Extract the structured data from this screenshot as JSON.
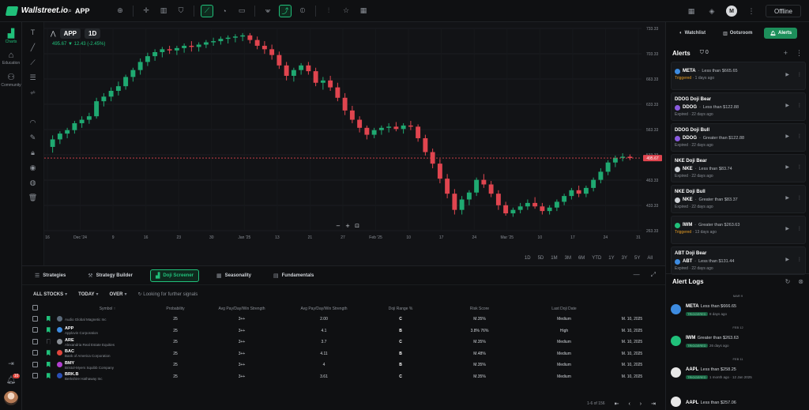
{
  "app": {
    "name": "Wallstreet.io"
  },
  "search": {
    "ticker": "APP"
  },
  "header": {
    "status": "Offline",
    "avatar_initial": "M"
  },
  "left_nav": [
    {
      "label": "Charts",
      "active": true
    },
    {
      "label": "Education",
      "active": false
    },
    {
      "label": "Community",
      "active": false
    }
  ],
  "notifications": {
    "badge": "10"
  },
  "chart": {
    "symbol": "APP",
    "interval": "1D",
    "quote": "495.67 ▼ 12.43 (-2.45%)",
    "last_price_label": "495.67",
    "timeframes": [
      "1D",
      "5D",
      "1M",
      "3M",
      "6M",
      "YTD",
      "1Y",
      "3Y",
      "5Y",
      "All"
    ]
  },
  "chart_data": {
    "type": "candlestick",
    "y_ticks": [
      "733.33",
      "703.33",
      "663.33",
      "633.33",
      "563.33",
      "533.33",
      "463.33",
      "433.33",
      "263.33"
    ],
    "x_ticks": [
      "16",
      "Dec '24",
      "9",
      "16",
      "23",
      "30",
      "Jan '25",
      "13",
      "21",
      "27",
      "Feb '25",
      "10",
      "17",
      "24",
      "Mar '25",
      "10",
      "17",
      "24",
      "31"
    ],
    "ylim": [
      370,
      720
    ],
    "last_price": 495.67,
    "candles": [
      [
        515,
        535,
        505,
        528
      ],
      [
        528,
        542,
        520,
        538
      ],
      [
        538,
        548,
        530,
        544
      ],
      [
        544,
        560,
        538,
        556
      ],
      [
        556,
        568,
        548,
        562
      ],
      [
        562,
        574,
        555,
        568
      ],
      [
        568,
        600,
        564,
        594
      ],
      [
        594,
        608,
        585,
        602
      ],
      [
        602,
        618,
        594,
        612
      ],
      [
        612,
        628,
        604,
        620
      ],
      [
        620,
        640,
        614,
        636
      ],
      [
        636,
        652,
        628,
        648
      ],
      [
        648,
        668,
        640,
        662
      ],
      [
        662,
        678,
        655,
        672
      ],
      [
        672,
        684,
        664,
        679
      ],
      [
        679,
        688,
        670,
        684
      ],
      [
        684,
        690,
        676,
        682
      ],
      [
        682,
        690,
        674,
        686
      ],
      [
        686,
        694,
        678,
        690
      ],
      [
        690,
        698,
        680,
        688
      ],
      [
        688,
        696,
        680,
        692
      ],
      [
        692,
        700,
        686,
        696
      ],
      [
        696,
        704,
        690,
        698
      ],
      [
        698,
        706,
        692,
        702
      ],
      [
        702,
        708,
        694,
        704
      ],
      [
        704,
        710,
        696,
        706
      ],
      [
        706,
        712,
        698,
        708
      ],
      [
        708,
        712,
        694,
        700
      ],
      [
        700,
        706,
        684,
        690
      ],
      [
        690,
        698,
        676,
        684
      ],
      [
        684,
        692,
        666,
        674
      ],
      [
        674,
        680,
        650,
        656
      ],
      [
        656,
        662,
        630,
        638
      ],
      [
        638,
        652,
        628,
        648
      ],
      [
        648,
        660,
        640,
        656
      ],
      [
        656,
        662,
        640,
        646
      ],
      [
        646,
        652,
        620,
        626
      ],
      [
        626,
        636,
        614,
        630
      ],
      [
        630,
        638,
        612,
        618
      ],
      [
        618,
        626,
        594,
        600
      ],
      [
        600,
        608,
        570,
        578
      ],
      [
        578,
        586,
        556,
        562
      ],
      [
        562,
        568,
        540,
        548
      ],
      [
        548,
        552,
        528,
        536
      ],
      [
        536,
        548,
        530,
        544
      ],
      [
        544,
        552,
        536,
        548
      ],
      [
        548,
        556,
        540,
        550
      ],
      [
        550,
        558,
        542,
        546
      ],
      [
        546,
        556,
        538,
        552
      ],
      [
        552,
        560,
        544,
        550
      ],
      [
        550,
        554,
        524,
        530
      ],
      [
        530,
        536,
        500,
        506
      ],
      [
        506,
        512,
        478,
        486
      ],
      [
        486,
        494,
        452,
        460
      ],
      [
        460,
        468,
        426,
        434
      ],
      [
        434,
        442,
        398,
        406
      ],
      [
        406,
        430,
        398,
        424
      ],
      [
        424,
        440,
        414,
        436
      ],
      [
        436,
        462,
        430,
        458
      ],
      [
        458,
        468,
        444,
        450
      ],
      [
        450,
        456,
        428,
        434
      ],
      [
        434,
        440,
        406,
        414
      ],
      [
        414,
        420,
        396,
        400
      ],
      [
        400,
        410,
        394,
        406
      ],
      [
        406,
        418,
        400,
        412
      ],
      [
        412,
        424,
        406,
        418
      ],
      [
        418,
        428,
        408,
        412
      ],
      [
        412,
        418,
        398,
        404
      ],
      [
        404,
        414,
        398,
        410
      ],
      [
        410,
        424,
        404,
        420
      ],
      [
        420,
        434,
        414,
        430
      ],
      [
        430,
        444,
        424,
        440
      ],
      [
        440,
        448,
        428,
        434
      ],
      [
        434,
        448,
        428,
        444
      ],
      [
        444,
        462,
        438,
        458
      ],
      [
        458,
        478,
        452,
        472
      ],
      [
        472,
        492,
        466,
        488
      ],
      [
        488,
        500,
        480,
        496
      ],
      [
        496,
        504,
        490,
        498
      ],
      [
        498,
        502,
        492,
        495.67
      ]
    ]
  },
  "screener": {
    "tabs": [
      {
        "label": "Strategies",
        "icon": "list-icon",
        "active": false
      },
      {
        "label": "Strategy Builder",
        "icon": "wrench-icon",
        "active": false
      },
      {
        "label": "Doji Screener",
        "icon": "chart-icon",
        "active": true
      },
      {
        "label": "Seasonality",
        "icon": "calendar-icon",
        "active": false
      },
      {
        "label": "Fundamentals",
        "icon": "document-icon",
        "active": false
      }
    ],
    "filters": [
      "ALL STOCKS",
      "TODAY",
      "OVER"
    ],
    "loop_text": "Looking for further signals",
    "columns": [
      "",
      "",
      "",
      "Symbol ↑",
      "Probability",
      "Avg Pay/Day/Win Strength",
      "Avg Pay/Day/Win Strength",
      "Doji Range %",
      "Risk Score",
      "Last Doji Date"
    ],
    "rows": [
      {
        "symbol": "",
        "name": "Audio Global Magnetic Inc",
        "bookmark": true,
        "color": "#5b6a7a",
        "prob": "25",
        "pdays": "3++",
        "strength": "2.00",
        "grade": "C",
        "range": "M.35%",
        "risk": "Medium",
        "date": "M. 10, 2025"
      },
      {
        "symbol": "APP",
        "name": "Applovin Corporation",
        "bookmark": true,
        "color": "#3d8be0",
        "prob": "25",
        "pdays": "3++",
        "strength": "4.1",
        "grade": "B",
        "range": "3.8% 76%",
        "risk": "High",
        "date": "M. 10, 2025"
      },
      {
        "symbol": "ARE",
        "name": "Alexandria Real Estate Equities",
        "bookmark": false,
        "color": "#8a8f96",
        "prob": "25",
        "pdays": "3++",
        "strength": "3.7",
        "grade": "C",
        "range": "M.35%",
        "risk": "Medium",
        "date": "M. 10, 2025"
      },
      {
        "symbol": "BAC",
        "name": "Bank of America Corporation",
        "bookmark": true,
        "color": "#e0463d",
        "prob": "25",
        "pdays": "3++",
        "strength": "4.11",
        "grade": "B",
        "range": "M.48%",
        "risk": "Medium",
        "date": "M. 10, 2025"
      },
      {
        "symbol": "BMY",
        "name": "Bristol-Myers Squibb Company",
        "bookmark": true,
        "color": "#b23fd1",
        "prob": "25",
        "pdays": "3++",
        "strength": "4",
        "grade": "B",
        "range": "M.35%",
        "risk": "Medium",
        "date": "M. 10, 2025"
      },
      {
        "symbol": "BRK.B",
        "name": "Berkshire Hathaway Inc",
        "bookmark": true,
        "color": "#2a4fb5",
        "prob": "25",
        "pdays": "3++",
        "strength": "3.61",
        "grade": "C",
        "range": "M.35%",
        "risk": "Medium",
        "date": "M. 10, 2025"
      }
    ],
    "pager_info": "1-6 of 156"
  },
  "right_panel": {
    "tabs": [
      {
        "label": "Watchlist",
        "active": false
      },
      {
        "label": "Ootsroom",
        "active": false
      },
      {
        "label": "Alerts",
        "active": true
      }
    ],
    "alerts_title": "Alerts",
    "alerts_count": "0",
    "alerts": [
      {
        "title": "",
        "symbol": "META",
        "cond": "Less than $665.65",
        "status": "Triggered",
        "age": "1 days ago",
        "color": "#3d8be0"
      },
      {
        "title": "DDOG Doji Bear",
        "symbol": "DDOG",
        "cond": "Less than $122.88",
        "status": "Expired",
        "age": "22 days ago",
        "color": "#8a5be0"
      },
      {
        "title": "DDOG Doji Bull",
        "symbol": "DDOG",
        "cond": "Greater than $122.88",
        "status": "Expired",
        "age": "22 days ago",
        "color": "#8a5be0"
      },
      {
        "title": "NKE Doji Bear",
        "symbol": "NKE",
        "cond": "Less than $83.74",
        "status": "Expired",
        "age": "22 days ago",
        "color": "#cfd3d8"
      },
      {
        "title": "NKE Doji Bull",
        "symbol": "NKE",
        "cond": "Greater than $83.37",
        "status": "Expired",
        "age": "22 days ago",
        "color": "#cfd3d8"
      },
      {
        "title": "",
        "symbol": "IWM",
        "cond": "Greater than $263.63",
        "status": "Triggered",
        "age": "13 days ago",
        "color": "#20c07a"
      },
      {
        "title": "ABT Doji Bear",
        "symbol": "ABT",
        "cond": "Less than $131.44",
        "status": "Expired",
        "age": "22 days ago",
        "color": "#3d8be0"
      }
    ],
    "logs_title": "Alert Logs",
    "logs": [
      {
        "date": "MAR 9",
        "symbol": "META",
        "cond": "Less than $666.65",
        "badge": "TRIGGERED",
        "time": "8 days ago",
        "color": "#3d8be0"
      },
      {
        "date": "FEB 12",
        "symbol": "IWM",
        "cond": "Greater than $263.63",
        "badge": "TRIGGERED",
        "time": "26 days ago",
        "color": "#20c07a"
      },
      {
        "date": "FEB 11",
        "symbol": "AAPL",
        "cond": "Less than $258.25",
        "badge": "TRIGGERED",
        "time": "1 month ago · 12 Jan 2025",
        "color": "#e8e8e8"
      },
      {
        "date": "",
        "symbol": "AAPL",
        "cond": "Less than $257.06",
        "badge": "",
        "time": "",
        "color": "#e8e8e8"
      }
    ]
  }
}
